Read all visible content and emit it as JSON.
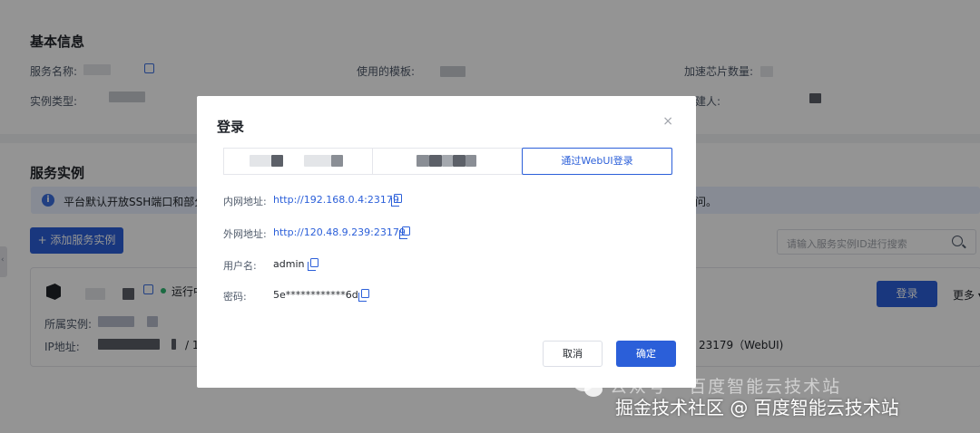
{
  "basic_info": {
    "title": "基本信息",
    "service_name_label": "服务名称:",
    "template_label": "使用的模板:",
    "chip_count_label": "加速芯片数量:",
    "instance_type_label": "实例类型:",
    "creator_label_partial": "建人:"
  },
  "service_instances": {
    "title": "服务实例",
    "notice_text": "平台默认开放SSH端口和部分V",
    "notice_tail": "问。",
    "add_button": "+ 添加服务实例",
    "search_placeholder": "请输入服务实例ID进行搜索",
    "card": {
      "status": "运行中",
      "belongs_label": "所属实例:",
      "ip_label": "IP地址:",
      "ip_partial": "/ 1:",
      "login_button": "登录",
      "more_button": "更多",
      "port_info": "23179（WebUI)"
    }
  },
  "modal": {
    "title": "登录",
    "close_icon": "×",
    "active_tab": "通过WebUI登录",
    "rows": [
      {
        "label": "内网地址:",
        "value": "http://192.168.0.4:23179"
      },
      {
        "label": "外网地址:",
        "value": "http://120.48.9.239:23179"
      },
      {
        "label": "用户名:",
        "value": "admin"
      },
      {
        "label": "密码:",
        "value": "5e************6d"
      }
    ],
    "cancel_button": "取消",
    "confirm_button": "确定"
  },
  "watermark": {
    "line1": "公众号 · 百度智能云技术站",
    "line2": "掘金技术社区 @ 百度智能云技术站"
  },
  "colors": {
    "primary": "#2b5fd9",
    "overlay": "rgba(0,0,0,0.42)",
    "running": "#2fb872"
  }
}
